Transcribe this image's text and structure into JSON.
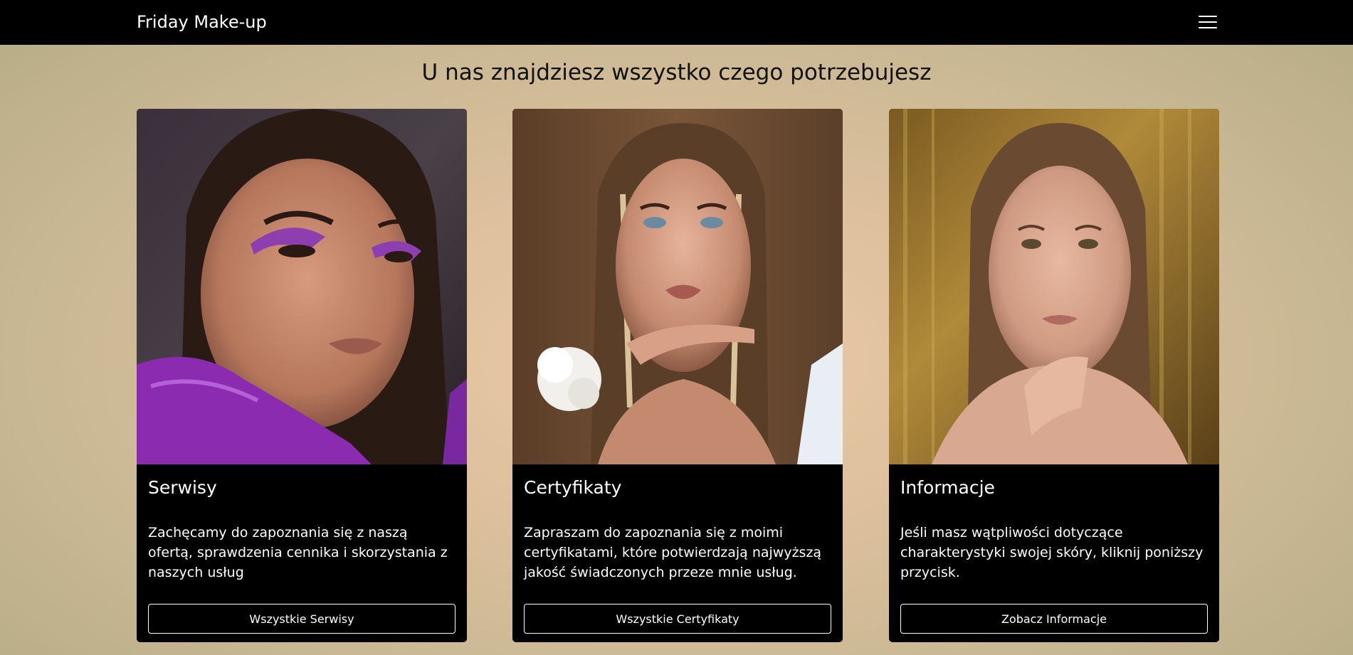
{
  "navbar": {
    "brand": "Friday Make-up",
    "menu_icon": "hamburger-menu-icon"
  },
  "main": {
    "heading": "U nas znajdziesz wszystko czego potrzebujesz"
  },
  "cards": [
    {
      "title": "Serwisy",
      "text": "Zachęcamy do zapoznania się z naszą ofertą, sprawdzenia cennika i skorzystania z naszych usług",
      "button": "Wszystkie Serwisy",
      "photo": "portrait with purple eyeshadow and purple gloves"
    },
    {
      "title": "Certyfikaty",
      "text": "Zapraszam do zapoznania się z moimi certyfikatami, które potwierdzają najwyższą jakość świadczonych przeze mnie usług.",
      "button": "Wszystkie Certyfikaty",
      "photo": "portrait with white scrunchie bracelet on brown background"
    },
    {
      "title": "Informacje",
      "text": "Jeśli masz wątpliwości dotyczące charakterystyki swojej skóry, kliknij poniższy przycisk.",
      "button": "Zobacz Informacje",
      "photo": "portrait on golden sequin background"
    }
  ],
  "colors": {
    "navbar": "#000000",
    "card": "#000000",
    "text_light": "#ffffff",
    "page_bg": "#dfc3a2"
  }
}
